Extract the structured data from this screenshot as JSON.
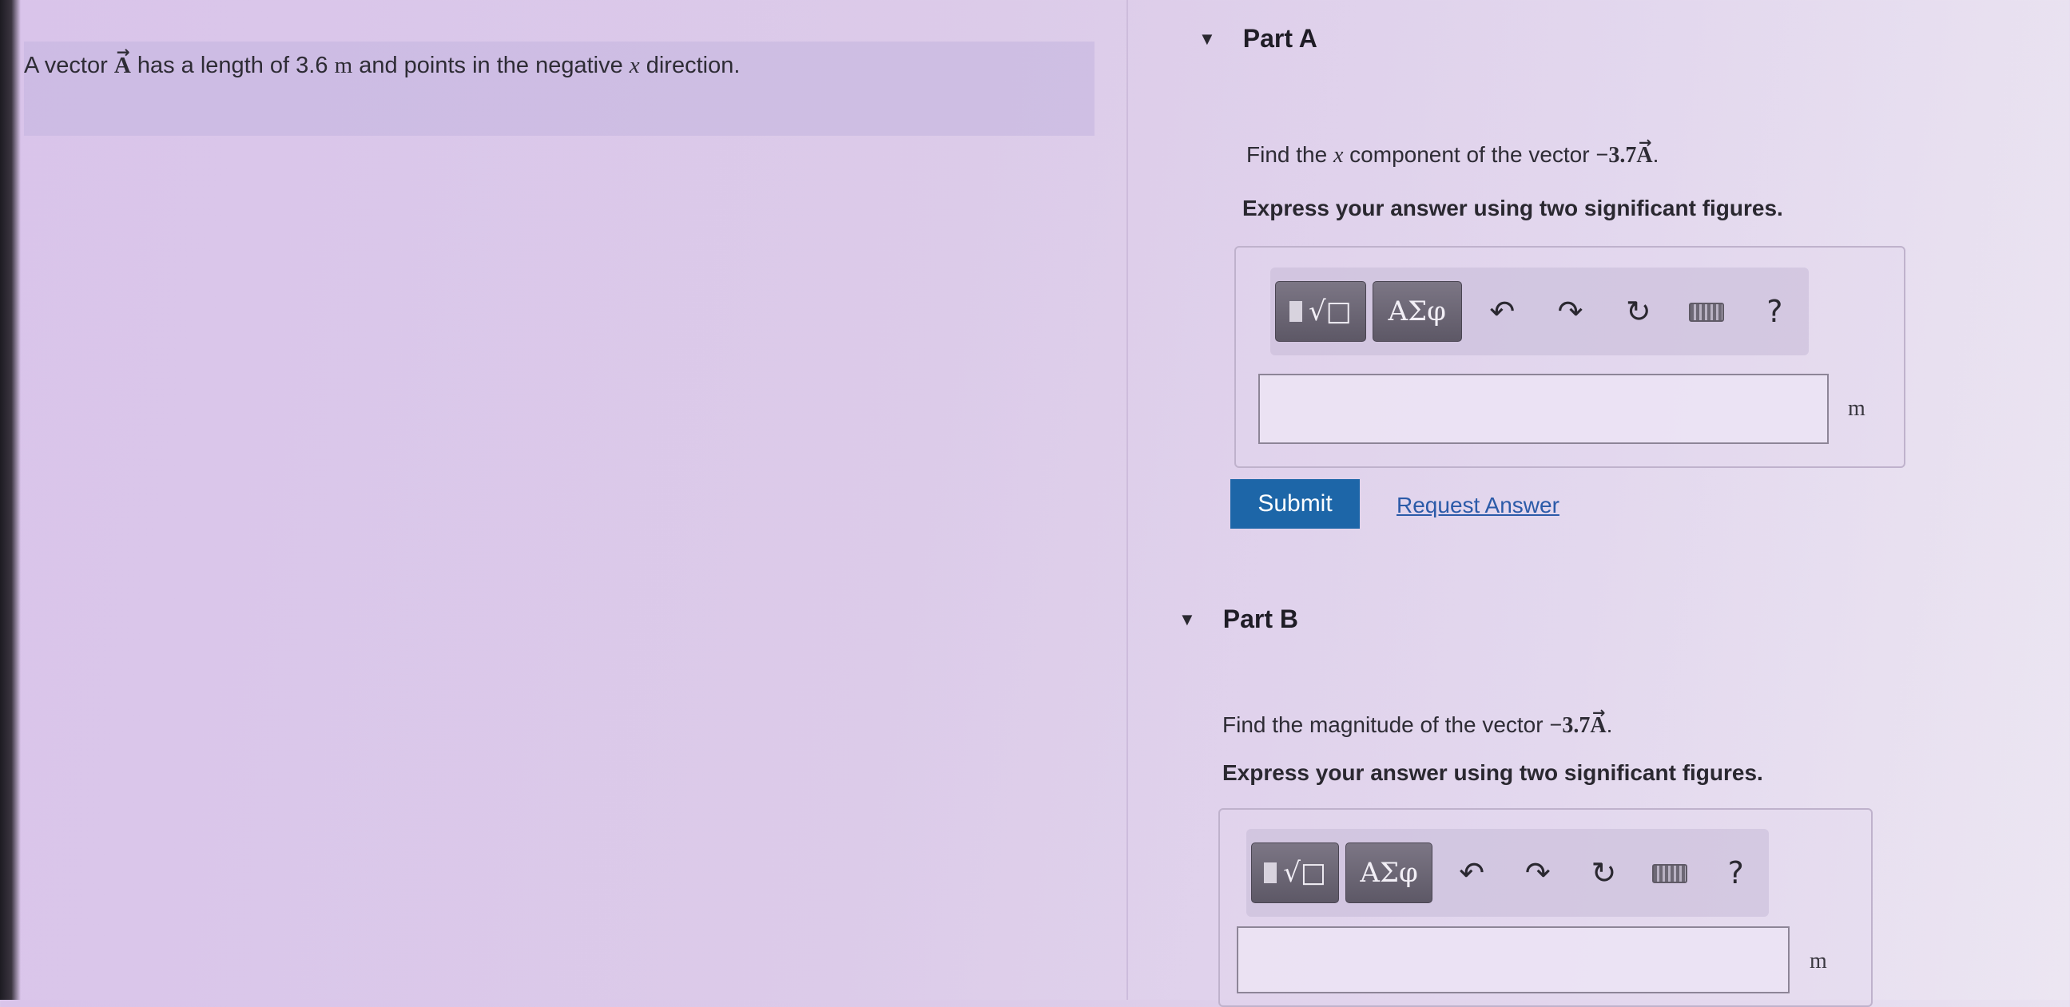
{
  "intro": {
    "prefix": "A vector",
    "vector_symbol": "A",
    "middle": "has a length of 3.6",
    "unit": "m",
    "after_unit": "and points in the negative",
    "axis": "x",
    "suffix": "direction."
  },
  "parts": [
    {
      "title": "Part A",
      "question_prefix": "Find the",
      "axis": "x",
      "question_middle": "component of the vector",
      "expression": "−3.7",
      "vector_symbol": "A",
      "end": ".",
      "instruction": "Express your answer using two significant figures.",
      "toolbar": {
        "template_icon": "templates-icon",
        "greek_label": "ΑΣφ",
        "undo_icon": "undo-icon",
        "redo_icon": "redo-icon",
        "reset_icon": "reset-icon",
        "keyboard_icon": "keyboard-icon",
        "help_label": "?"
      },
      "answer_value": "",
      "unit": "m"
    },
    {
      "title": "Part B",
      "question_prefix": "Find the magnitude of the vector",
      "expression": "−3.7",
      "vector_symbol": "A",
      "end": ".",
      "instruction": "Express your answer using two significant figures.",
      "toolbar": {
        "template_icon": "templates-icon",
        "greek_label": "ΑΣφ",
        "undo_icon": "undo-icon",
        "redo_icon": "redo-icon",
        "reset_icon": "reset-icon",
        "keyboard_icon": "keyboard-icon",
        "help_label": "?"
      },
      "answer_value": "",
      "unit": "m"
    }
  ],
  "actions": {
    "submit_label": "Submit",
    "request_label": "Request Answer"
  }
}
